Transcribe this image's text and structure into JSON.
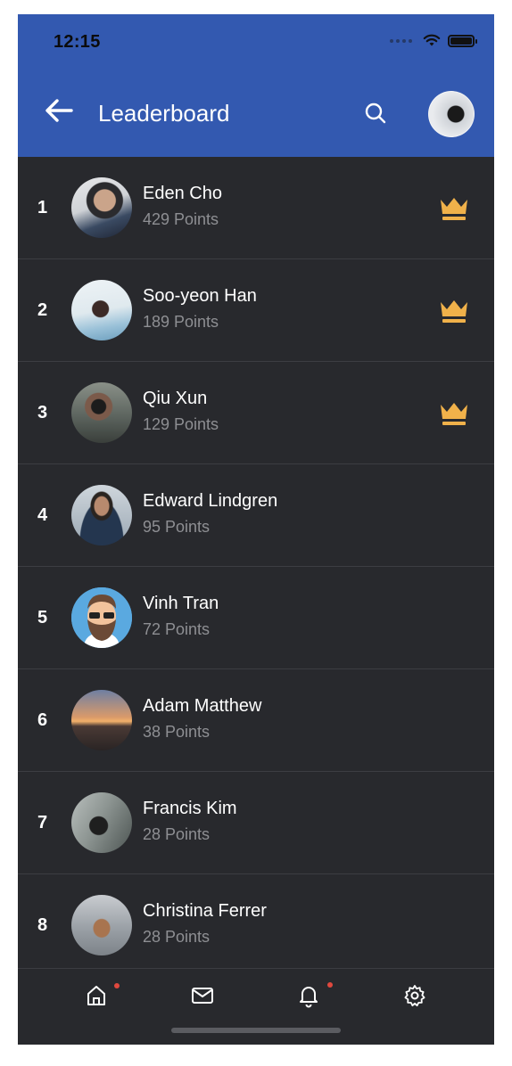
{
  "status_bar": {
    "time": "12:15"
  },
  "header": {
    "title": "Leaderboard",
    "back_icon": "arrow-left-icon",
    "search_icon": "search-icon"
  },
  "colors": {
    "header_bg": "#3359b0",
    "list_bg": "#28292d",
    "crown": "#f0b14a",
    "notification_dot": "#e0483e",
    "points_text": "#8e8f93"
  },
  "leaderboard": [
    {
      "rank": "1",
      "name": "Eden Cho",
      "points": "429 Points",
      "crown": true
    },
    {
      "rank": "2",
      "name": "Soo-yeon Han",
      "points": "189 Points",
      "crown": true
    },
    {
      "rank": "3",
      "name": "Qiu Xun",
      "points": "129 Points",
      "crown": true
    },
    {
      "rank": "4",
      "name": "Edward Lindgren",
      "points": "95 Points",
      "crown": false
    },
    {
      "rank": "5",
      "name": "Vinh Tran",
      "points": "72 Points",
      "crown": false
    },
    {
      "rank": "6",
      "name": "Adam Matthew",
      "points": "38 Points",
      "crown": false
    },
    {
      "rank": "7",
      "name": "Francis Kim",
      "points": "28 Points",
      "crown": false
    },
    {
      "rank": "8",
      "name": "Christina Ferrer",
      "points": "28 Points",
      "crown": false
    }
  ],
  "bottom_nav": [
    {
      "icon": "home-icon",
      "badge": true
    },
    {
      "icon": "mail-icon",
      "badge": false
    },
    {
      "icon": "bell-icon",
      "badge": true
    },
    {
      "icon": "gear-icon",
      "badge": false
    }
  ]
}
